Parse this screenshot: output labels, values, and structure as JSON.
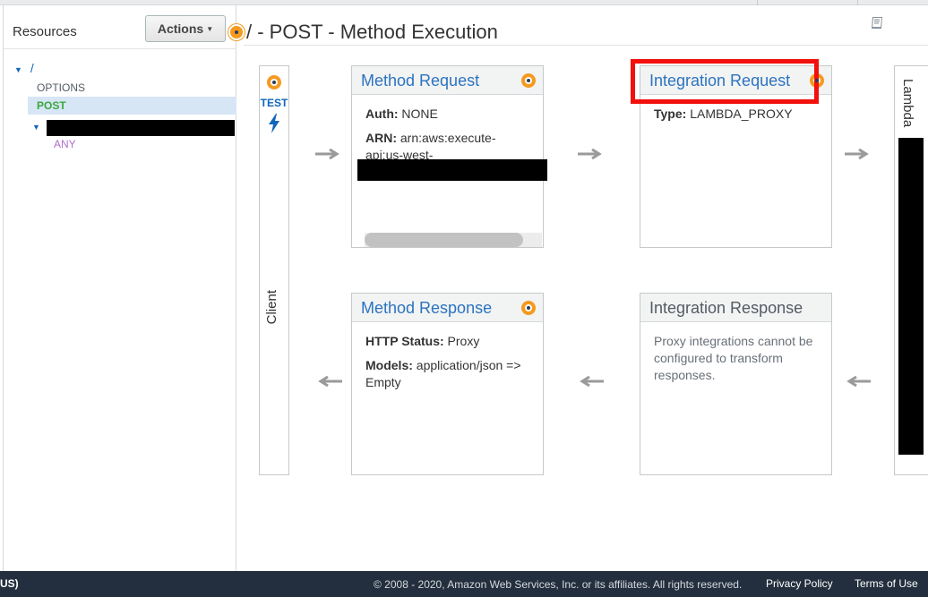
{
  "sidebar": {
    "title": "Resources",
    "actions_label": "Actions",
    "tree": {
      "root": "/",
      "options": "OPTIONS",
      "post": "POST",
      "child_method": "ANY"
    }
  },
  "main": {
    "title": "/ - POST - Method Execution",
    "client": {
      "test_label": "TEST",
      "label": "Client"
    },
    "lambda_label": "Lambda",
    "method_request": {
      "title": "Method Request",
      "auth_key": "Auth:",
      "auth_value": " NONE",
      "arn_key": "ARN:",
      "arn_value": " arn:aws:execute-api:us-west-"
    },
    "integration_request": {
      "title": "Integration Request",
      "type_key": "Type:",
      "type_value": " LAMBDA_PROXY"
    },
    "method_response": {
      "title": "Method Response",
      "status_key": "HTTP Status:",
      "status_value": " Proxy",
      "models_key": "Models:",
      "models_value": " application/json => Empty"
    },
    "integration_response": {
      "title": "Integration Response",
      "note": "Proxy integrations cannot be configured to transform responses."
    }
  },
  "footer": {
    "locale": "US)",
    "copyright": "© 2008 - 2020, Amazon Web Services, Inc. or its affiliates. All rights reserved.",
    "privacy": "Privacy Policy",
    "terms": "Terms of Use"
  },
  "colors": {
    "link_blue": "#2b74c0",
    "orange_dot": "#f59a1e",
    "highlight_red": "#f2100c",
    "footer_bg": "#232f3e",
    "post_green": "#3fa63f",
    "any_purple": "#b06fd0"
  }
}
